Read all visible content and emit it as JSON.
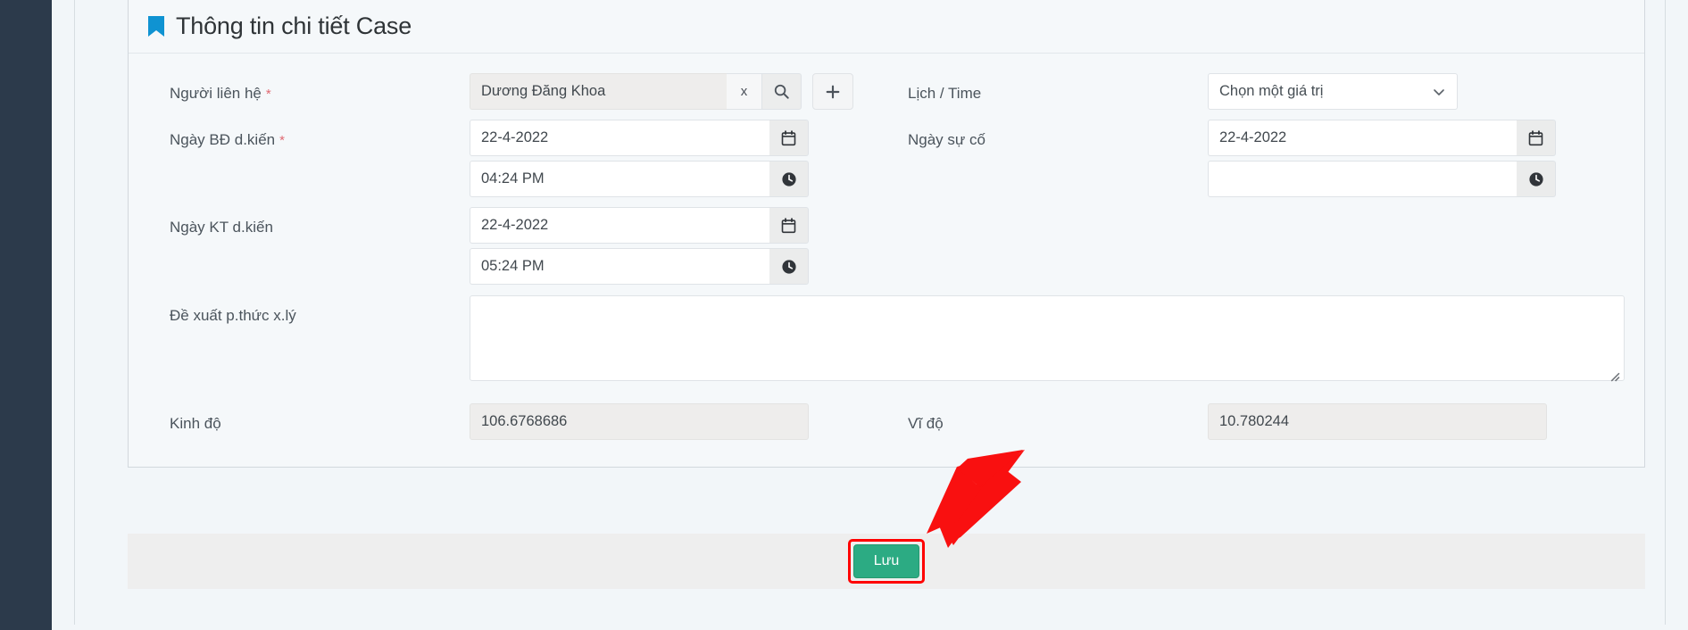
{
  "header": {
    "title": "Thông tin chi tiết Case",
    "icon": "bookmark-icon",
    "icon_color": "#0f93d2"
  },
  "form": {
    "contact": {
      "label": "Người liên hệ",
      "required": "*",
      "value": "Dương Đăng Khoa",
      "clear_label": "x",
      "search_icon": "search-icon",
      "add_icon": "plus-icon"
    },
    "schedule": {
      "label": "Lịch / Time",
      "selected": "Chọn một giá trị",
      "chevron": "chevron-down-icon"
    },
    "start_date": {
      "label": "Ngày BĐ d.kiến",
      "required": "*",
      "date_value": "22-4-2022",
      "time_value": "04:24 PM",
      "date_icon": "calendar-icon",
      "time_icon": "clock-icon"
    },
    "incident_date": {
      "label": "Ngày sự cố",
      "date_value": "22-4-2022",
      "time_value": "",
      "date_icon": "calendar-icon",
      "time_icon": "clock-icon"
    },
    "end_date": {
      "label": "Ngày KT d.kiến",
      "date_value": "22-4-2022",
      "time_value": "05:24 PM",
      "date_icon": "calendar-icon",
      "time_icon": "clock-icon"
    },
    "proposal": {
      "label": "Đề xuất p.thức x.lý",
      "value": ""
    },
    "longitude": {
      "label": "Kinh độ",
      "value": "106.6768686"
    },
    "latitude": {
      "label": "Vĩ độ",
      "value": "10.780244"
    }
  },
  "footer": {
    "save_label": "Lưu",
    "save_color": "#2cab83",
    "highlight_color": "#ff0000"
  },
  "annotation": {
    "arrow": "red-arrow-pointer",
    "arrow_color": "#f91010"
  }
}
